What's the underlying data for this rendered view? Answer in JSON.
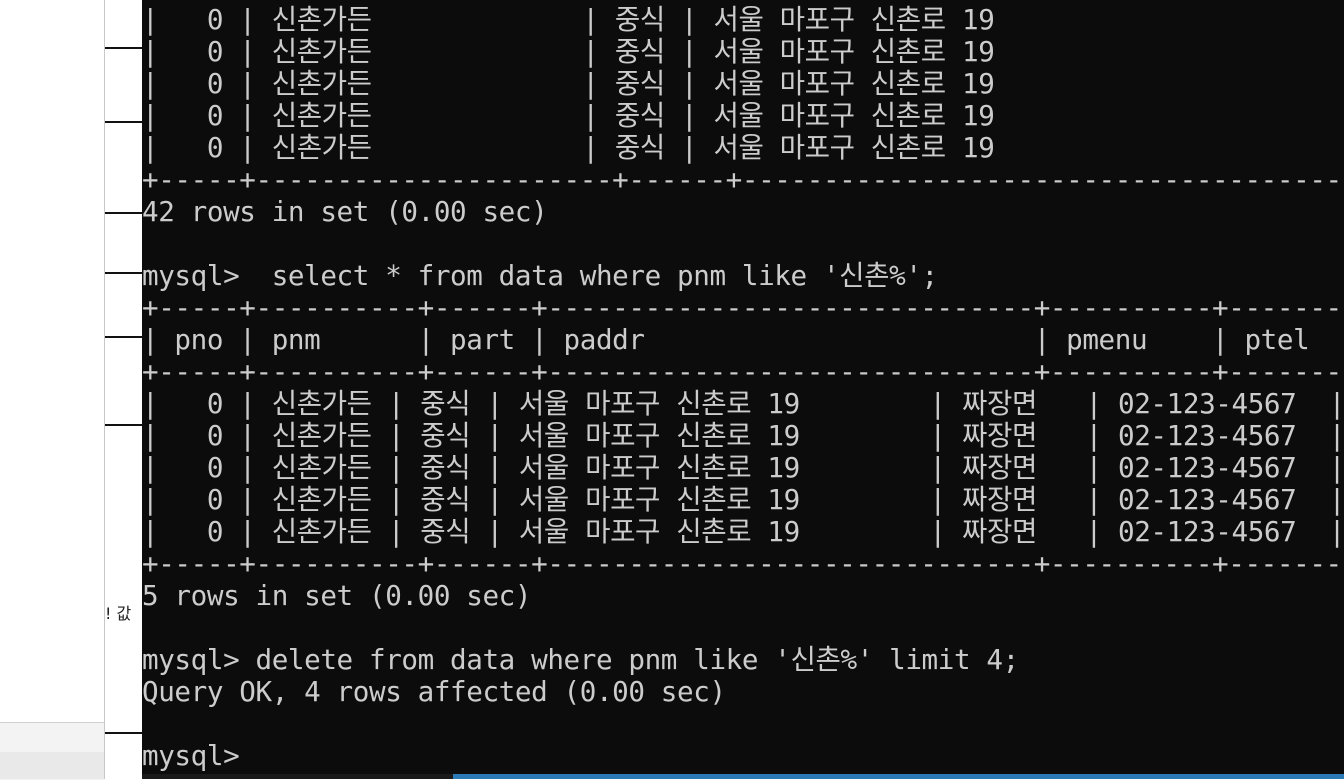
{
  "background": {
    "side_fragment": "! 값"
  },
  "terminal": {
    "lines": [
      "|   0 | 신촌가든             | 중식 | 서울 마포구 신촌로 19",
      "|   0 | 신촌가든             | 중식 | 서울 마포구 신촌로 19",
      "|   0 | 신촌가든             | 중식 | 서울 마포구 신촌로 19",
      "|   0 | 신촌가든             | 중식 | 서울 마포구 신촌로 19",
      "|   0 | 신촌가든             | 중식 | 서울 마포구 신촌로 19",
      "+-----+----------------------+------+---------------------------------------------",
      "42 rows in set (0.00 sec)",
      "",
      "mysql>  select * from data where pnm like '신촌%';",
      "+-----+----------+------+------------------------------+----------+--------------+",
      "| pno | pnm      | part | paddr                        | pmenu    | ptel         |",
      "+-----+----------+------+------------------------------+----------+--------------+",
      "|   0 | 신촌가든 | 중식 | 서울 마포구 신촌로 19        | 짜장면   | 02-123-4567  |",
      "|   0 | 신촌가든 | 중식 | 서울 마포구 신촌로 19        | 짜장면   | 02-123-4567  |",
      "|   0 | 신촌가든 | 중식 | 서울 마포구 신촌로 19        | 짜장면   | 02-123-4567  |",
      "|   0 | 신촌가든 | 중식 | 서울 마포구 신촌로 19        | 짜장면   | 02-123-4567  |",
      "|   0 | 신촌가든 | 중식 | 서울 마포구 신촌로 19        | 짜장면   | 02-123-4567  |",
      "+-----+----------+------+------------------------------+----------+--------------+",
      "5 rows in set (0.00 sec)",
      "",
      "mysql> delete from data where pnm like '신촌%' limit 4;",
      "Query OK, 4 rows affected (0.00 sec)",
      "",
      "mysql>"
    ]
  }
}
